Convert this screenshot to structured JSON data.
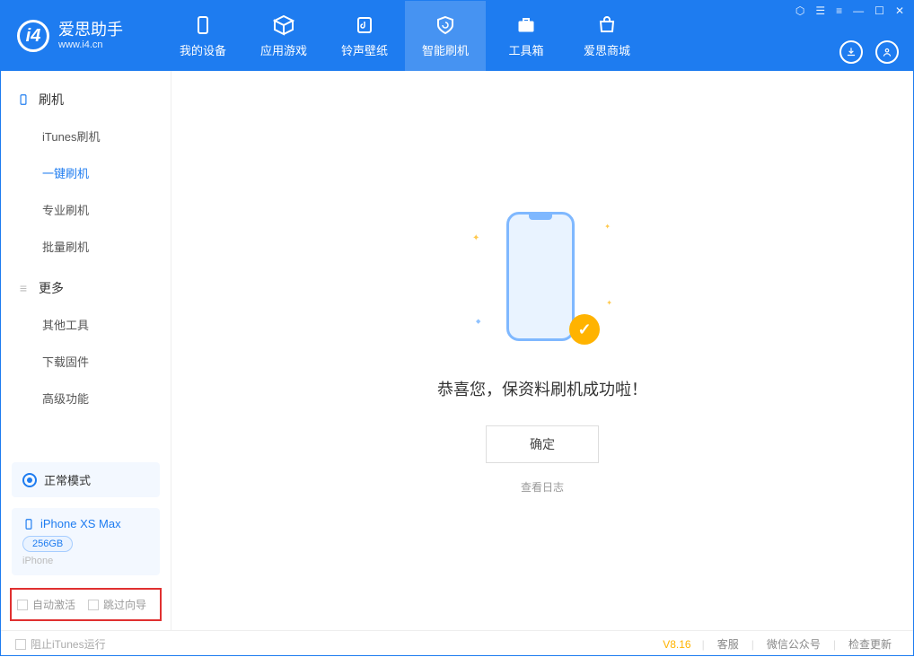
{
  "header": {
    "logo_title": "爱思助手",
    "logo_sub": "www.i4.cn",
    "tabs": [
      {
        "label": "我的设备"
      },
      {
        "label": "应用游戏"
      },
      {
        "label": "铃声壁纸"
      },
      {
        "label": "智能刷机"
      },
      {
        "label": "工具箱"
      },
      {
        "label": "爱思商城"
      }
    ]
  },
  "sidebar": {
    "section1_title": "刷机",
    "items1": [
      {
        "label": "iTunes刷机"
      },
      {
        "label": "一键刷机"
      },
      {
        "label": "专业刷机"
      },
      {
        "label": "批量刷机"
      }
    ],
    "section2_title": "更多",
    "items2": [
      {
        "label": "其他工具"
      },
      {
        "label": "下载固件"
      },
      {
        "label": "高级功能"
      }
    ],
    "mode_label": "正常模式",
    "device_name": "iPhone XS Max",
    "device_capacity": "256GB",
    "device_type": "iPhone",
    "opt_auto_activate": "自动激活",
    "opt_skip_guide": "跳过向导"
  },
  "main": {
    "success_text": "恭喜您，保资料刷机成功啦！",
    "ok_button": "确定",
    "view_log": "查看日志"
  },
  "footer": {
    "block_itunes": "阻止iTunes运行",
    "version": "V8.16",
    "link_service": "客服",
    "link_wechat": "微信公众号",
    "link_update": "检查更新"
  }
}
